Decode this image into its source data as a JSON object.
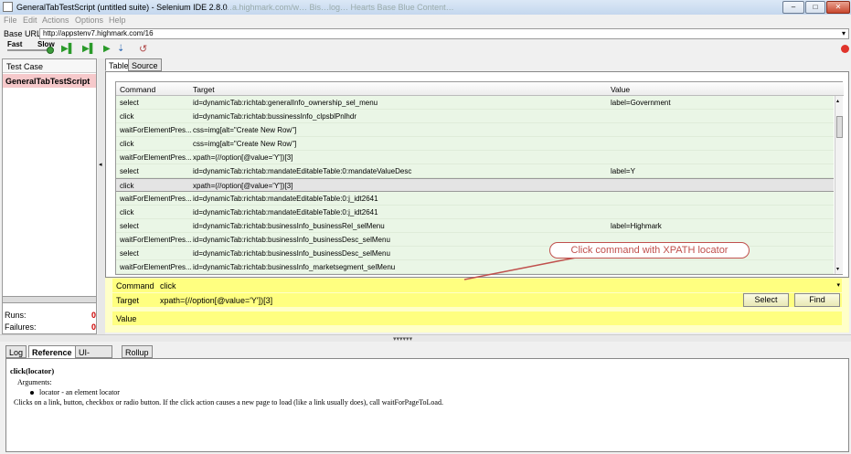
{
  "window": {
    "title": "GeneralTabTestScript (untitled suite) - Selenium IDE 2.8.0",
    "ghost_title": "…a.highmark.com/w…  Bis…log…   Hearts Base Blue Content…",
    "minimize": "–",
    "maximize": "□",
    "close": "✕"
  },
  "menu": [
    "File",
    "Edit",
    "Actions",
    "Options",
    "Help"
  ],
  "base_url": {
    "label": "Base URL",
    "value": "http://appstenv7.highmark.com/16"
  },
  "toolbar": {
    "fast": "Fast",
    "slow": "Slow"
  },
  "test_case_panel": {
    "header": "Test Case",
    "items": [
      "GeneralTabTestScript"
    ]
  },
  "stats": {
    "runs_label": "Runs:",
    "runs_value": "0",
    "failures_label": "Failures:",
    "failures_value": "0"
  },
  "tabs": [
    "Table",
    "Source"
  ],
  "grid": {
    "headers": [
      "Command",
      "Target",
      "Value"
    ],
    "rows": [
      [
        "select",
        "id=dynamicTab:richtab:generalInfo_ownership_sel_menu",
        "label=Government"
      ],
      [
        "click",
        "id=dynamicTab:richtab:bussinessInfo_clpsblPnlhdr",
        ""
      ],
      [
        "waitForElementPres...",
        "css=img[alt=\"Create New Row\"]",
        ""
      ],
      [
        "click",
        "css=img[alt=\"Create New Row\"]",
        ""
      ],
      [
        "waitForElementPres...",
        "xpath=(//option[@value='Y'])[3]",
        ""
      ],
      [
        "select",
        "id=dynamicTab:richtab:mandateEditableTable:0:mandateValueDesc",
        "label=Y"
      ],
      [
        "click",
        "xpath=(//option[@value='Y'])[3]",
        ""
      ],
      [
        "waitForElementPres...",
        "id=dynamicTab:richtab:mandateEditableTable:0:j_idt2641",
        ""
      ],
      [
        "click",
        "id=dynamicTab:richtab:mandateEditableTable:0:j_idt2641",
        ""
      ],
      [
        "select",
        "id=dynamicTab:richtab:businessInfo_businessRel_selMenu",
        "label=Highmark"
      ],
      [
        "waitForElementPres...",
        "id=dynamicTab:richtab:businessInfo_businessDesc_selMenu",
        ""
      ],
      [
        "select",
        "id=dynamicTab:richtab:businessInfo_businessDesc_selMenu",
        ""
      ],
      [
        "waitForElementPres...",
        "id=dynamicTab:richtab:businessInfo_marketsegment_selMenu",
        ""
      ]
    ],
    "selected_row": 6
  },
  "editor": {
    "command_label": "Command",
    "command_value": "click",
    "target_label": "Target",
    "target_value": "xpath=(//option[@value='Y'])[3]",
    "value_label": "Value",
    "value_value": "",
    "select_button": "Select",
    "find_button": "Find"
  },
  "callout": "Click command with XPATH locator",
  "bottom_tabs": [
    "Log",
    "Reference",
    "UI-Element",
    "Rollup"
  ],
  "reference": {
    "signature": "click(locator)",
    "args_label": "Arguments:",
    "arg1": "locator - an element locator",
    "description": "Clicks on a link, button, checkbox or radio button. If the click action causes a new page to load (like a link usually does), call waitForPageToLoad."
  }
}
